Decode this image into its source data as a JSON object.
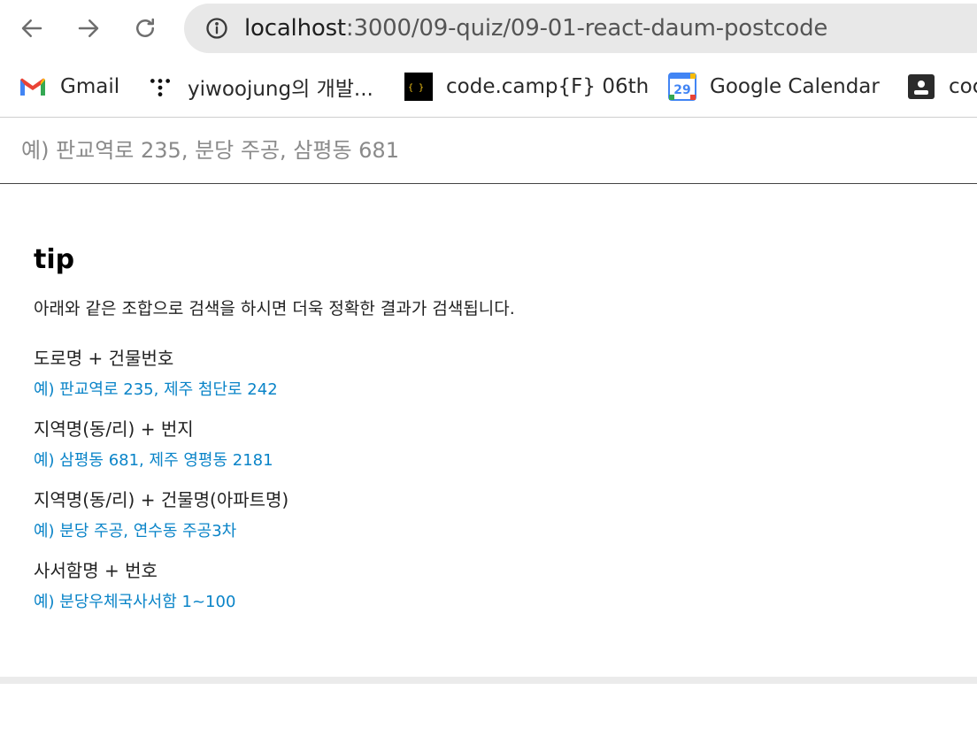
{
  "browser": {
    "url_host": "localhost",
    "url_path": ":3000/09-quiz/09-01-react-daum-postcode",
    "bookmarks": [
      {
        "label": "Gmail",
        "icon": "gmail-icon"
      },
      {
        "label": "yiwoojung의 개발...",
        "icon": "dots-logo-icon"
      },
      {
        "label": "code.camp{F} 06th",
        "icon": "codecamp-icon"
      },
      {
        "label": "Google Calendar",
        "icon": "calendar-icon",
        "icon_text": "29"
      },
      {
        "label": "coc",
        "icon": "contact-icon"
      }
    ]
  },
  "search": {
    "placeholder": "예) 판교역로 235, 분당 주공, 삼평동 681"
  },
  "tip": {
    "title": "tip",
    "description": "아래와 같은 조합으로 검색을 하시면 더욱 정확한 결과가 검색됩니다.",
    "rules": [
      {
        "label": "도로명 + 건물번호",
        "example": "예) 판교역로 235,  제주 첨단로 242"
      },
      {
        "label": "지역명(동/리) + 번지",
        "example": "예) 삼평동 681,  제주 영평동 2181"
      },
      {
        "label": "지역명(동/리) + 건물명(아파트명)",
        "example": "예) 분당 주공,  연수동 주공3차"
      },
      {
        "label": "사서함명 + 번호",
        "example": "예) 분당우체국사서함 1~100"
      }
    ]
  },
  "colors": {
    "example_link": "#0a84c8",
    "omnibox_bg": "#e8e8e8"
  }
}
